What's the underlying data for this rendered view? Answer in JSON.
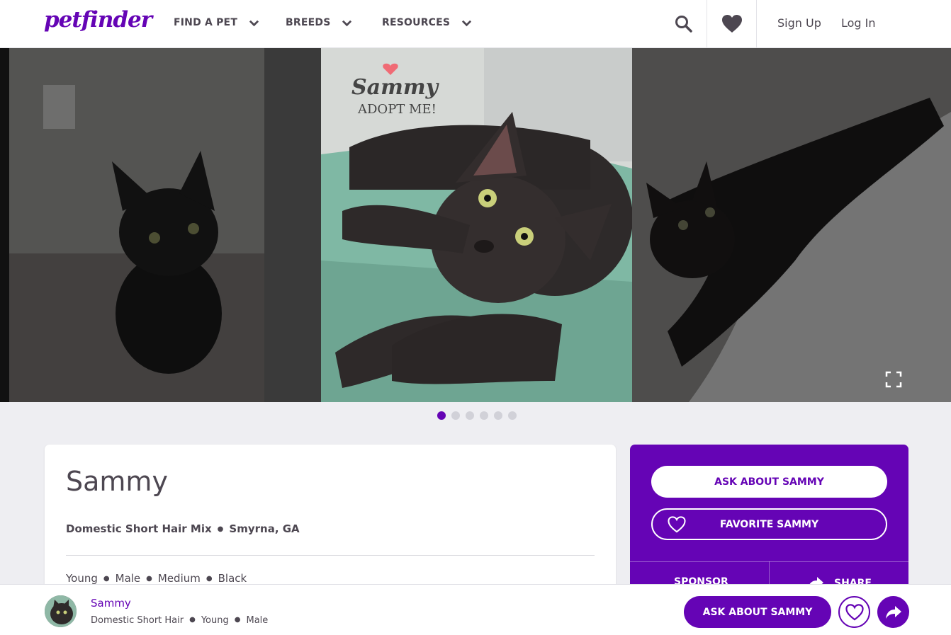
{
  "colors": {
    "brand": "#6504b5",
    "text": "#4d4751",
    "background": "#eeeef2"
  },
  "header": {
    "logo": "petfinder",
    "nav": [
      {
        "label": "FIND A PET"
      },
      {
        "label": "BREEDS"
      },
      {
        "label": "RESOURCES"
      }
    ],
    "search_icon": "search-icon",
    "favorites_icon": "heart-icon",
    "sign_up": "Sign Up",
    "log_in": "Log In"
  },
  "carousel": {
    "slide_overlay_text": {
      "name": "Sammy",
      "tagline": "ADOPT ME!"
    },
    "dot_count": 6,
    "active_dot": 1
  },
  "pet": {
    "name": "Sammy",
    "breed": "Domestic Short Hair Mix",
    "location": "Smyrna, GA",
    "age": "Young",
    "sex": "Male",
    "size": "Medium",
    "color": "Black"
  },
  "panel": {
    "ask_label": "ASK ABOUT SAMMY",
    "favorite_label": "FAVORITE SAMMY",
    "sponsor_label": "SPONSOR",
    "share_label": "SHARE"
  },
  "sticky": {
    "name": "Sammy",
    "breed": "Domestic Short Hair",
    "age": "Young",
    "sex": "Male",
    "ask_label": "ASK ABOUT SAMMY"
  }
}
